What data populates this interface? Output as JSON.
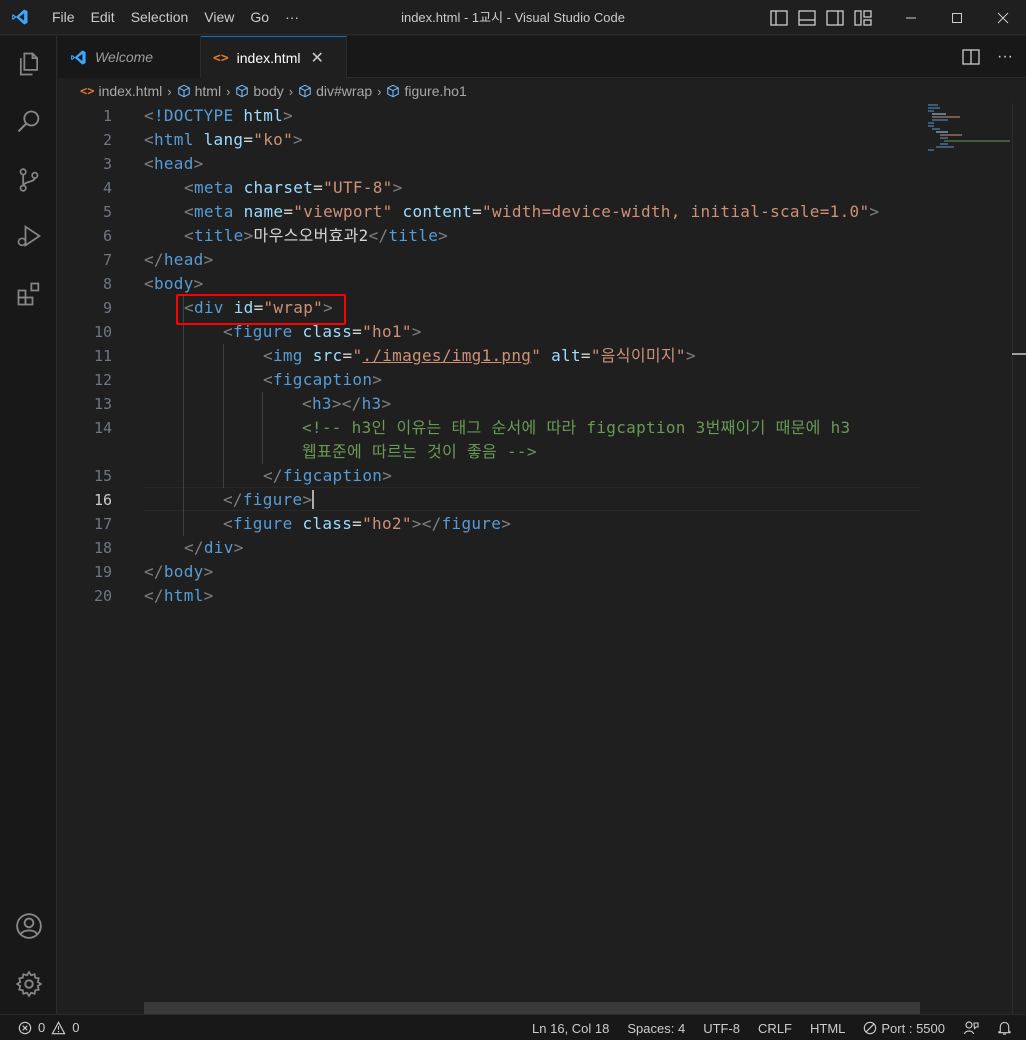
{
  "titlebar": {
    "menu": [
      "File",
      "Edit",
      "Selection",
      "View",
      "Go",
      "···"
    ],
    "title": "index.html - 1교시 - Visual Studio Code"
  },
  "tabs": [
    {
      "label": "Welcome",
      "icon": "vscode-icon",
      "active": false
    },
    {
      "label": "index.html",
      "icon": "html-file-icon",
      "active": true,
      "close": "✕"
    }
  ],
  "breadcrumb": [
    {
      "label": "index.html",
      "icon": "html-file-icon"
    },
    {
      "label": "html",
      "icon": "element-cube-icon"
    },
    {
      "label": "body",
      "icon": "element-cube-icon"
    },
    {
      "label": "div#wrap",
      "icon": "element-cube-icon"
    },
    {
      "label": "figure.ho1",
      "icon": "element-cube-icon"
    }
  ],
  "editor": {
    "current_line": 16,
    "line_numbers": [
      "1",
      "2",
      "3",
      "4",
      "5",
      "6",
      "7",
      "8",
      "9",
      "10",
      "11",
      "12",
      "13",
      "14",
      "",
      "15",
      "16",
      "17",
      "18",
      "19",
      "20"
    ],
    "lines": {
      "l1": [
        "<",
        "!DOCTYPE",
        " ",
        "html",
        ">"
      ],
      "l2": [
        "<",
        "html",
        " ",
        "lang",
        "=",
        "\"ko\"",
        ">"
      ],
      "l3": [
        "<",
        "head",
        ">"
      ],
      "l4": [
        "<",
        "meta",
        " ",
        "charset",
        "=",
        "\"UTF-8\"",
        ">"
      ],
      "l5": [
        "<",
        "meta",
        " ",
        "name",
        "=",
        "\"viewport\"",
        " ",
        "content",
        "=",
        "\"width=device-width, initial-scale=1.0\"",
        ">"
      ],
      "l6": [
        "<",
        "title",
        ">",
        "마우스오버효과2",
        "</",
        "title",
        ">"
      ],
      "l7": [
        "</",
        "head",
        ">"
      ],
      "l8": [
        "<",
        "body",
        ">"
      ],
      "l9": [
        "<",
        "div",
        " ",
        "id",
        "=",
        "\"wrap\"",
        ">"
      ],
      "l10": [
        "<",
        "figure",
        " ",
        "class",
        "=",
        "\"ho1\"",
        ">"
      ],
      "l11": [
        "<",
        "img",
        " ",
        "src",
        "=",
        "\"",
        "./images/img1.png",
        "\"",
        " ",
        "alt",
        "=",
        "\"음식이미지\"",
        ">"
      ],
      "l12": [
        "<",
        "figcaption",
        ">"
      ],
      "l13": [
        "<",
        "h3",
        "></",
        "h3",
        ">"
      ],
      "l14a": "<!-- h3인 이유는 태그 순서에 따라 figcaption 3번째이기 때문에 h3",
      "l14b": "웹표준에 따르는 것이 좋음 -->",
      "l15": [
        "</",
        "figcaption",
        ">"
      ],
      "l16": [
        "</",
        "figure",
        ">"
      ],
      "l17": [
        "<",
        "figure",
        " ",
        "class",
        "=",
        "\"ho2\"",
        "></",
        "figure",
        ">"
      ],
      "l18": [
        "</",
        "div",
        ">"
      ],
      "l19": [
        "</",
        "body",
        ">"
      ],
      "l20": [
        "</",
        "html",
        ">"
      ]
    },
    "highlighted_element": "<div id=\"wrap\">"
  },
  "statusbar": {
    "errors": "0",
    "warnings": "0",
    "position": "Ln 16, Col 18",
    "spaces": "Spaces: 4",
    "encoding": "UTF-8",
    "eol": "CRLF",
    "language": "HTML",
    "port": "Port : 5500"
  },
  "colors": {
    "tag": "#569cd6",
    "attribute": "#9cdcfe",
    "string": "#ce9178",
    "comment": "#6a9955",
    "accent": "#0078d4",
    "highlight_box": "#ff0000"
  }
}
